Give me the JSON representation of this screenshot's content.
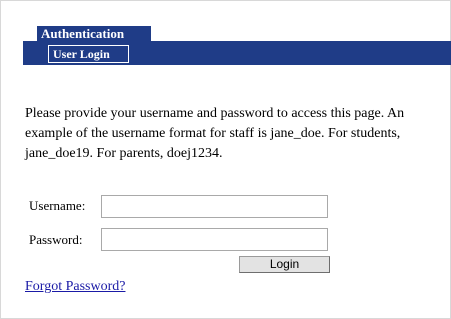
{
  "header": {
    "section_tab_label": "Authentication",
    "active_tab_label": "User Login"
  },
  "login": {
    "intro_text": "Please provide your username and password to access this page. An example of the username format for staff is jane_doe. For students, jane_doe19. For parents, doej1234.",
    "username_label": "Username:",
    "username_value": "",
    "password_label": "Password:",
    "password_value": "",
    "submit_label": "Login",
    "forgot_link": "Forgot Password?"
  },
  "colors": {
    "header_bg": "#1f3c87",
    "link": "#1a1aa6"
  }
}
